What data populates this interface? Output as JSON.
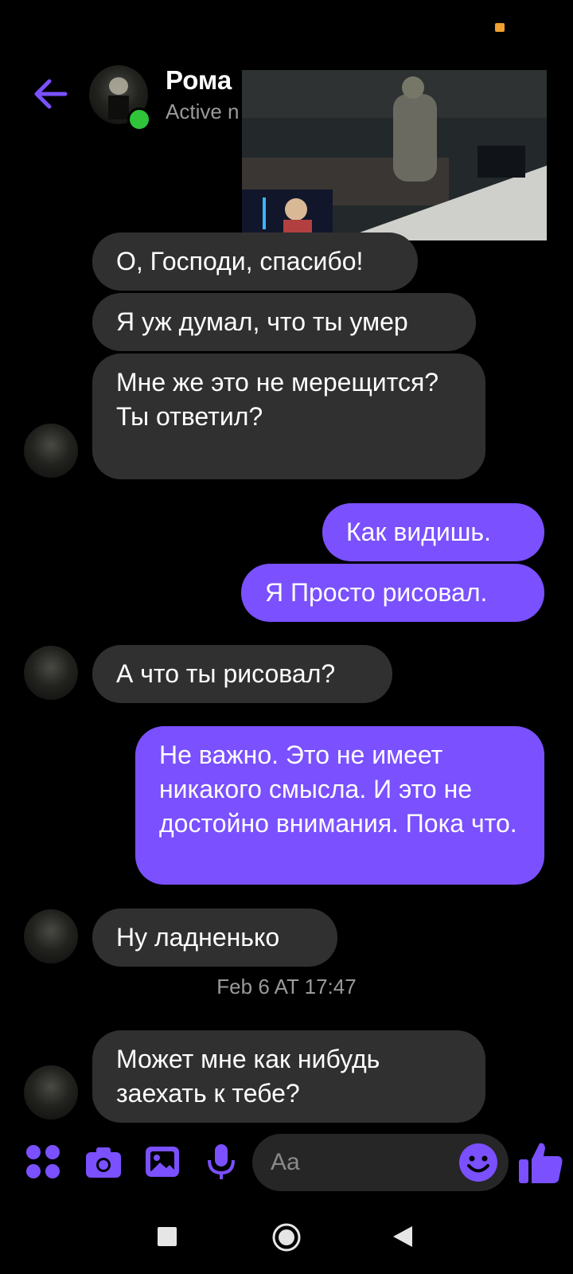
{
  "header": {
    "contact_name": "Рома",
    "status": "Active n"
  },
  "messages": [
    {
      "side": "in",
      "text": "О, Господи, спасибо!"
    },
    {
      "side": "in",
      "text": "Я уж думал, что ты умер"
    },
    {
      "side": "in",
      "text": "Мне же это не мерещится? Ты ответил?"
    },
    {
      "side": "out",
      "text": "Как видишь."
    },
    {
      "side": "out",
      "text": "Я Просто рисовал."
    },
    {
      "side": "in",
      "text": "А что ты рисовал?"
    },
    {
      "side": "out",
      "text": "Не важно. Это не имеет никакого смысла. И это не достойно внимания. Пока что."
    },
    {
      "side": "in",
      "text": "Ну ладненько"
    },
    {
      "side": "in",
      "text": "Может мне как нибудь заехать к тебе?"
    }
  ],
  "timestamp": "Feb 6 AT 17:47",
  "composer": {
    "placeholder": "Aa",
    "icons": [
      "apps-icon",
      "camera-icon",
      "gallery-icon",
      "microphone-icon",
      "emoji-icon",
      "thumbs-up-icon"
    ]
  },
  "colors": {
    "accent": "#7a50ff",
    "incoming_bubble": "#303030",
    "online": "#2fc43a",
    "background": "#000000"
  },
  "nav": [
    "recent-apps-icon",
    "home-icon",
    "back-icon"
  ]
}
